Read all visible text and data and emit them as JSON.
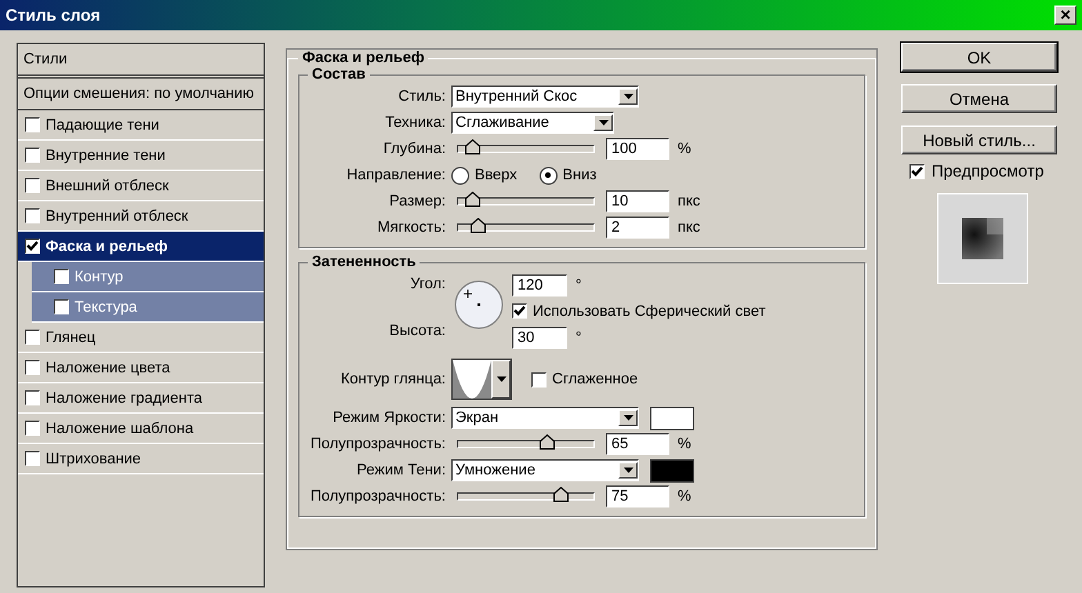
{
  "window": {
    "title": "Стиль слоя",
    "close": "×"
  },
  "sidebar": {
    "header": "Стили",
    "blending_options": "Опции смешения: по умолчанию",
    "items": [
      {
        "label": "Падающие тени",
        "checked": false,
        "selected": false
      },
      {
        "label": "Внутренние тени",
        "checked": false,
        "selected": false
      },
      {
        "label": "Внешний отблеск",
        "checked": false,
        "selected": false
      },
      {
        "label": "Внутренний отблеск",
        "checked": false,
        "selected": false
      },
      {
        "label": "Фаска и рельеф",
        "checked": true,
        "selected": true,
        "children": [
          {
            "label": "Контур",
            "checked": false,
            "selected": false
          },
          {
            "label": "Текстура",
            "checked": false,
            "selected": false
          }
        ]
      },
      {
        "label": "Глянец",
        "checked": false,
        "selected": false
      },
      {
        "label": "Наложение цвета",
        "checked": false,
        "selected": false
      },
      {
        "label": "Наложение градиента",
        "checked": false,
        "selected": false
      },
      {
        "label": "Наложение шаблона",
        "checked": false,
        "selected": false
      },
      {
        "label": "Штрихование",
        "checked": false,
        "selected": false
      }
    ]
  },
  "bevel": {
    "title": "Фаска и рельеф",
    "structure": {
      "title": "Состав",
      "rows": [
        {
          "kind": "select",
          "label": "Стиль:",
          "value": "Внутренний Скос"
        },
        {
          "kind": "select",
          "label": "Техника:",
          "value": "Сглаживание"
        },
        {
          "kind": "slider",
          "label": "Глубина:",
          "level": 0.1,
          "value": "100",
          "unit": "%"
        },
        {
          "kind": "radio",
          "label": "Направление:",
          "options": [
            {
              "label": "Вверх",
              "selected": false
            },
            {
              "label": "Вниз",
              "selected": true
            }
          ]
        },
        {
          "kind": "slider",
          "label": "Размер:",
          "level": 0.1,
          "value": "10",
          "unit": "пкс"
        },
        {
          "kind": "slider",
          "label": "Мягкость:",
          "level": 0.14,
          "value": "2",
          "unit": "пкс"
        }
      ]
    },
    "shading": {
      "title": "Затененность",
      "angle": {
        "label": "Угол:",
        "value": "120",
        "unit": "°"
      },
      "global_light": {
        "label": "Использовать Сферический свет",
        "checked": true
      },
      "altitude": {
        "label": "Высота:",
        "value": "30",
        "unit": "°"
      },
      "gloss_contour": {
        "label": "Контур глянца:"
      },
      "anti_aliased": {
        "label": "Сглаженное",
        "checked": false
      },
      "rows": [
        {
          "kind": "mode",
          "label": "Режим Яркости:",
          "value": "Экран",
          "color": "#ffffff"
        },
        {
          "kind": "slider",
          "label": "Полупрозрачность:",
          "level": 0.65,
          "value": "65",
          "unit": "%"
        },
        {
          "kind": "mode",
          "label": "Режим Тени:",
          "value": "Умножение",
          "color": "#000000"
        },
        {
          "kind": "slider",
          "label": "Полупрозрачность:",
          "level": 0.75,
          "value": "75",
          "unit": "%"
        }
      ]
    }
  },
  "buttons": [
    "OK",
    "Отмена",
    "Новый стиль..."
  ],
  "preview": {
    "label": "Предпросмотр",
    "checked": true
  }
}
